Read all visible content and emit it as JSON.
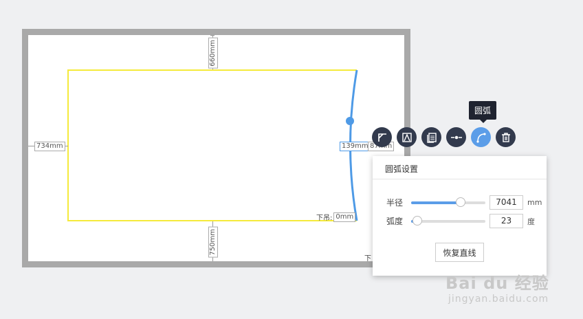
{
  "dimensions": {
    "top": "660mm",
    "left": "734mm",
    "bottom": "750mm",
    "right_inner": "139mm",
    "right_outer": "87mm",
    "hang_label": "下吊:",
    "hang_value": "0mm",
    "hang_label_2": "下"
  },
  "toolbar": {
    "tooltip": "圆弧",
    "buttons": [
      {
        "name": "corner-tool",
        "icon": "corner-icon"
      },
      {
        "name": "arch-tool",
        "icon": "triangle-frame-icon"
      },
      {
        "name": "copy-tool",
        "icon": "copy-icon"
      },
      {
        "name": "split-tool",
        "icon": "split-point-icon"
      },
      {
        "name": "arc-tool",
        "icon": "arc-icon",
        "active": true
      },
      {
        "name": "delete-tool",
        "icon": "trash-icon"
      }
    ]
  },
  "panel": {
    "title": "圆弧设置",
    "radius_label": "半径",
    "radius_value": "7041",
    "radius_unit": "mm",
    "radius_fraction": 0.67,
    "degree_label": "弧度",
    "degree_value": "23",
    "degree_unit": "度",
    "degree_fraction": 0.08,
    "reset_label": "恢复直线"
  },
  "watermark": {
    "brand": "Bai du 经验",
    "url": "jingyan.baidu.com"
  },
  "colors": {
    "wall_outline": "#f5ea3a",
    "arc": "#4e9ae6",
    "accent": "#5b9de8",
    "toolbar": "#323a4d"
  }
}
